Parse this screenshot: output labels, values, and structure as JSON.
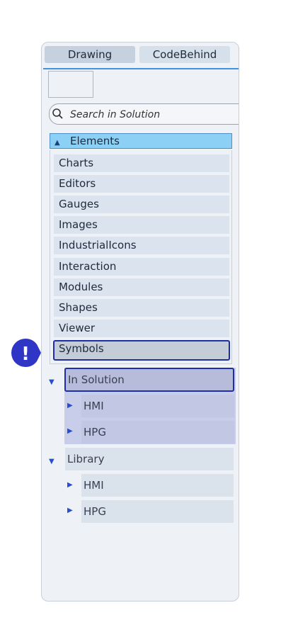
{
  "tabs": {
    "drawing": "Drawing",
    "codebehind": "CodeBehind"
  },
  "search": {
    "placeholder": "Search in Solution"
  },
  "elements": {
    "header": "Elements",
    "items": [
      "Charts",
      "Editors",
      "Gauges",
      "Images",
      "IndustrialIcons",
      "Interaction",
      "Modules",
      "Shapes",
      "Viewer",
      "Symbols"
    ],
    "selected": "Symbols"
  },
  "tree": {
    "in_solution": {
      "label": "In Solution",
      "children": [
        "HMI",
        "HPG"
      ]
    },
    "library": {
      "label": "Library",
      "children": [
        "HMI",
        "HPG"
      ]
    }
  },
  "badge": {
    "glyph": "!",
    "color": "#2f35c4"
  },
  "colors": {
    "accent": "#3f95e3",
    "selection_border": "#1e2ea7",
    "elements_header": "#8dd0f6"
  }
}
